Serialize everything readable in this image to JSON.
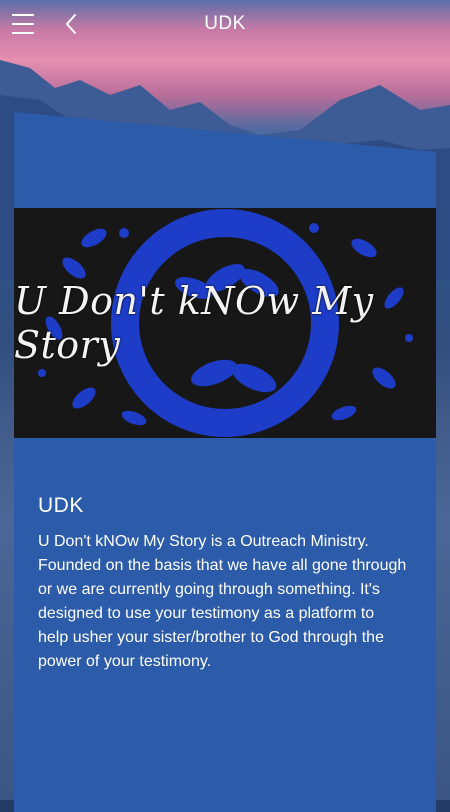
{
  "header": {
    "title": "UDK",
    "menu_icon": "hamburger-menu-icon",
    "back_icon": "chevron-left-icon"
  },
  "banner": {
    "text": "U Don't kNOw My Story",
    "background": "#171717",
    "pattern_color": "#1e3fd1"
  },
  "article": {
    "title": "UDK",
    "body": "U Don't kNOw My Story is a Outreach Ministry. Founded on the basis that we have all gone through or we are currently going through something. It's designed to use your testimony as a platform to help usher your sister/brother to God through the power of your testimony."
  },
  "colors": {
    "card": "#2c5ba9",
    "text": "#ffffff"
  }
}
